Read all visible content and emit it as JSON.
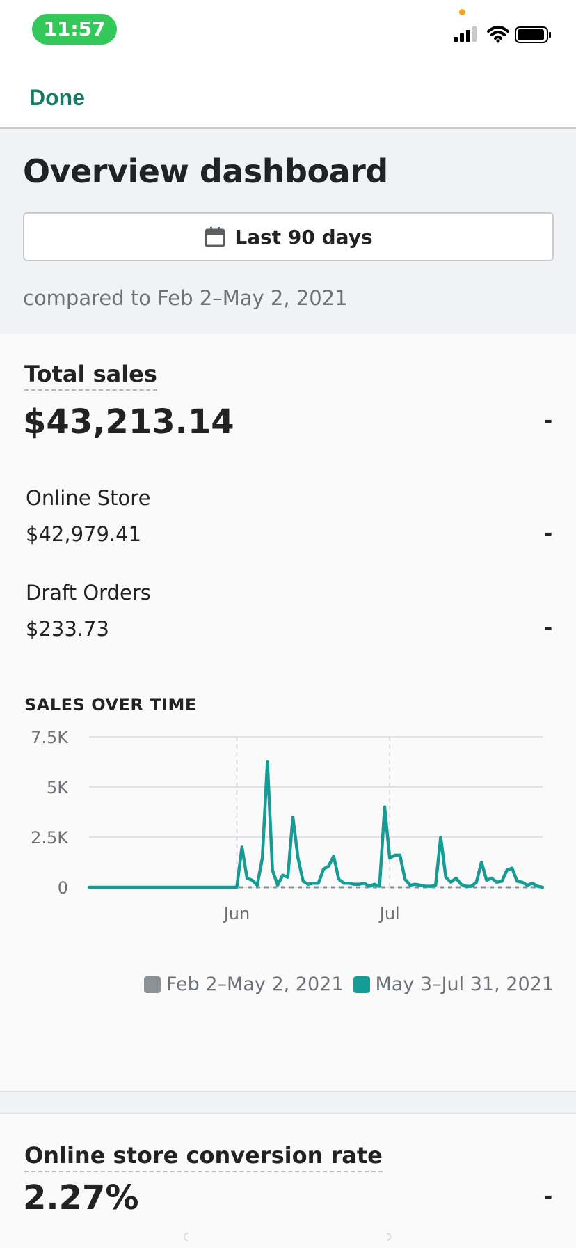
{
  "status_bar": {
    "time": "11:57",
    "icons": [
      "signal-icon",
      "wifi-icon",
      "battery-icon"
    ]
  },
  "nav": {
    "done_label": "Done"
  },
  "header": {
    "title": "Overview dashboard",
    "date_range_label": "Last 90 days",
    "compare_text": "compared to Feb 2–May 2, 2021"
  },
  "total_sales": {
    "label": "Total sales",
    "value": "$43,213.14",
    "change": "-",
    "breakdown": [
      {
        "label": "Online Store",
        "value": "$42,979.41",
        "change": "-"
      },
      {
        "label": "Draft Orders",
        "value": "$233.73",
        "change": "-"
      }
    ]
  },
  "sales_over_time": {
    "heading": "SALES OVER TIME"
  },
  "chart_data": {
    "type": "line",
    "title": "SALES OVER TIME",
    "xlabel": "",
    "ylabel": "",
    "ylim": [
      0,
      7500
    ],
    "y_ticks": [
      "7.5K",
      "5K",
      "2.5K",
      "0"
    ],
    "x_ticks": [
      "Jun",
      "Jul"
    ],
    "grid": true,
    "legend_placement": "bottom-right",
    "colors": {
      "previous": "#8c9196",
      "current": "#169c94"
    },
    "series": [
      {
        "name": "Feb 2–May 2, 2021",
        "values": [
          0,
          0,
          0,
          0,
          0,
          0,
          0,
          0,
          0,
          0,
          0,
          0,
          0,
          0,
          0,
          0,
          0,
          0,
          0,
          0,
          0,
          0,
          0,
          0,
          0,
          0,
          0,
          0,
          0,
          0,
          0,
          0,
          0,
          0,
          0,
          0,
          0,
          0,
          0,
          0,
          0,
          0,
          0,
          0,
          0,
          0,
          0,
          0,
          0,
          0,
          0,
          0,
          0,
          0,
          0,
          0,
          0,
          0,
          0,
          0,
          0,
          0,
          0,
          0,
          0,
          0,
          0,
          0,
          0,
          0,
          0,
          0,
          0,
          0,
          0,
          0,
          0,
          0,
          0,
          0,
          0,
          0,
          0,
          0,
          0,
          0,
          0,
          0,
          0,
          0
        ]
      },
      {
        "name": "May 3–Jul 31, 2021",
        "values": [
          0,
          0,
          0,
          0,
          0,
          0,
          0,
          0,
          0,
          0,
          0,
          0,
          0,
          0,
          0,
          0,
          0,
          0,
          0,
          0,
          0,
          0,
          0,
          0,
          0,
          0,
          0,
          0,
          0,
          0,
          2000,
          450,
          350,
          100,
          1450,
          6250,
          850,
          100,
          600,
          500,
          3500,
          1450,
          300,
          150,
          200,
          200,
          900,
          1050,
          1550,
          400,
          200,
          200,
          150,
          150,
          200,
          50,
          150,
          50,
          4000,
          1450,
          1600,
          1600,
          400,
          100,
          150,
          100,
          50,
          50,
          100,
          2500,
          500,
          250,
          450,
          150,
          50,
          50,
          250,
          1250,
          350,
          450,
          250,
          300,
          850,
          950,
          300,
          250,
          100,
          200,
          50,
          0
        ],
        "start_label": "May 3",
        "month_marks": [
          {
            "label": "Jun",
            "index": 29
          },
          {
            "label": "Jul",
            "index": 59
          }
        ]
      }
    ]
  },
  "legend": {
    "previous_label": "Feb 2–May 2, 2021",
    "current_label": "May 3–Jul 31, 2021"
  },
  "conversion": {
    "label": "Online store conversion rate",
    "value": "2.27%",
    "change": "-"
  }
}
